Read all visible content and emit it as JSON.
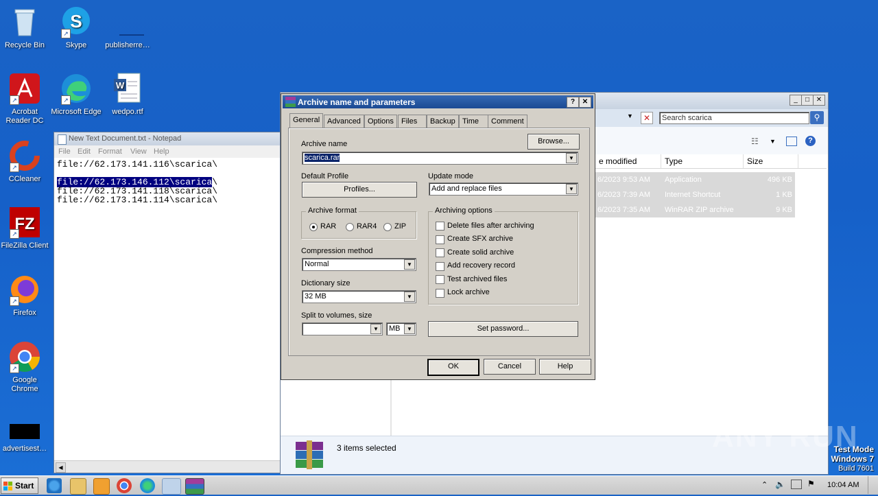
{
  "desktop": {
    "icons": [
      {
        "label": "Recycle Bin",
        "icon": "recycle-bin-icon"
      },
      {
        "label": "Skype",
        "icon": "skype-icon"
      },
      {
        "label": "publisherre…",
        "icon": "blank-file-icon"
      },
      {
        "label": "Acrobat Reader DC",
        "icon": "acrobat-icon"
      },
      {
        "label": "Microsoft Edge",
        "icon": "edge-icon"
      },
      {
        "label": "wedpo.rtf",
        "icon": "word-doc-icon"
      },
      {
        "label": "CCleaner",
        "icon": "ccleaner-icon"
      },
      {
        "label": "FileZilla Client",
        "icon": "filezilla-icon"
      },
      {
        "label": "Firefox",
        "icon": "firefox-icon"
      },
      {
        "label": "Google Chrome",
        "icon": "chrome-icon"
      },
      {
        "label": "advertisest…",
        "icon": "black-file-icon"
      }
    ]
  },
  "notepad": {
    "title": "New Text Document.txt - Notepad",
    "menu": [
      "File",
      "Edit",
      "Format",
      "View",
      "Help"
    ],
    "lines": [
      "file://62.173.141.116\\scarica\\",
      "",
      "file://62.173.146.112\\scarica",
      "file://62.173.141.118\\scarica\\",
      "file://62.173.141.114\\scarica\\"
    ],
    "selected_line_text": "file://62.173.146.112\\scarica",
    "selected_line_tail": "\\"
  },
  "explorer": {
    "search_placeholder": "Search scarica",
    "columns": [
      "e modified",
      "Type",
      "Size"
    ],
    "rows": [
      {
        "modified": "6/2023 9:53 AM",
        "type": "Application",
        "size": "496 KB"
      },
      {
        "modified": "6/2023 7:39 AM",
        "type": "Internet Shortcut",
        "size": "1 KB"
      },
      {
        "modified": "6/2023 7:35 AM",
        "type": "WinRAR ZIP archive",
        "size": "9 KB"
      }
    ],
    "status": "3 items selected"
  },
  "dialog": {
    "title": "Archive name and parameters",
    "help_btn": "?",
    "close_btn": "✕",
    "tabs": [
      "General",
      "Advanced",
      "Options",
      "Files",
      "Backup",
      "Time",
      "Comment"
    ],
    "archive_name_label": "Archive name",
    "browse_label": "Browse...",
    "archive_name_value": "scarica.rar",
    "default_profile_label": "Default Profile",
    "profiles_label": "Profiles...",
    "update_mode_label": "Update mode",
    "update_mode_value": "Add and replace files",
    "archive_format_label": "Archive format",
    "formats": [
      "RAR",
      "RAR4",
      "ZIP"
    ],
    "archiving_options_label": "Archiving options",
    "options": [
      "Delete files after archiving",
      "Create SFX archive",
      "Create solid archive",
      "Add recovery record",
      "Test archived files",
      "Lock archive"
    ],
    "compression_label": "Compression method",
    "compression_value": "Normal",
    "dictionary_label": "Dictionary size",
    "dictionary_value": "32 MB",
    "split_label": "Split to volumes, size",
    "split_unit": "MB",
    "set_password_label": "Set password...",
    "ok_label": "OK",
    "cancel_label": "Cancel",
    "help_label": "Help"
  },
  "taskbar": {
    "start_label": "Start",
    "clock": "10:04 AM"
  },
  "watermark": {
    "text": "ANY RUN",
    "test_mode": "Test Mode",
    "os": "Windows 7",
    "build": "Build 7601"
  }
}
